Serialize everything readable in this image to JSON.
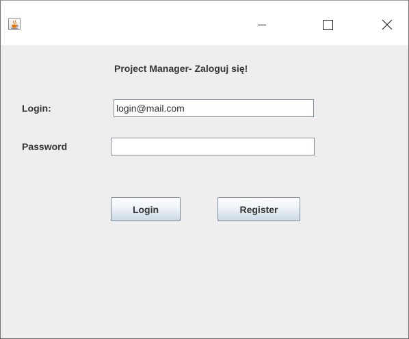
{
  "window": {
    "app_icon": "java-cup-icon",
    "controls": {
      "minimize_icon": "minimize-icon",
      "maximize_icon": "maximize-icon",
      "close_icon": "close-icon"
    }
  },
  "form": {
    "heading": "Project Manager- Zaloguj się!",
    "login": {
      "label": "Login:",
      "value": "login@mail.com"
    },
    "password": {
      "label": "Password",
      "value": ""
    },
    "buttons": {
      "login_label": "Login",
      "register_label": "Register"
    }
  },
  "colors": {
    "background": "#eeeeee",
    "titlebar": "#ffffff",
    "text": "#333333",
    "field_border": "#7a8a99"
  }
}
